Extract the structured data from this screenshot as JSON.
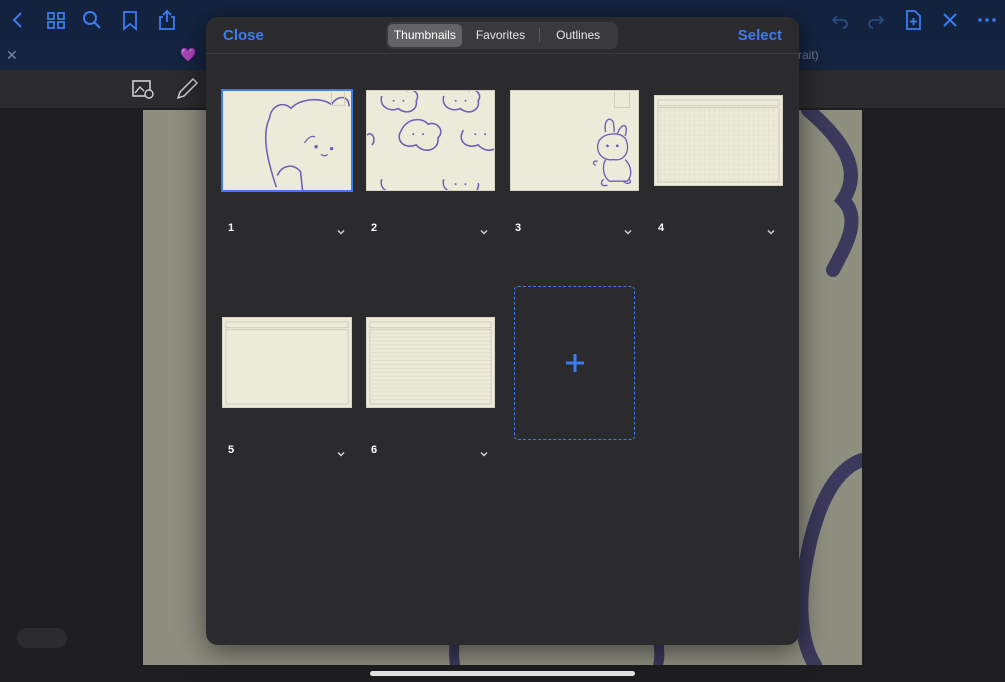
{
  "app": {
    "doc_title": "",
    "tab_title": "💜",
    "tab_right_text": "rait)"
  },
  "colors": {
    "accent": "#3d7bf0",
    "modal_bg": "#2b2b2e",
    "paper": "#ecebd9",
    "doodle": "#6e5fb8"
  },
  "topbar": {
    "icons": [
      "back-icon",
      "grid-icon",
      "search-icon",
      "bookmark-icon",
      "share-icon",
      "undo-icon",
      "redo-icon",
      "add-page-icon",
      "close-icon",
      "more-icon"
    ]
  },
  "modal": {
    "close_label": "Close",
    "select_label": "Select",
    "segments": [
      {
        "label": "Thumbnails",
        "active": true
      },
      {
        "label": "Favorites",
        "active": false
      },
      {
        "label": "Outlines",
        "active": false
      }
    ]
  },
  "thumbnails": [
    {
      "label": "1",
      "selected": true,
      "style": "bear"
    },
    {
      "label": "2",
      "selected": false,
      "style": "clouds"
    },
    {
      "label": "3",
      "selected": false,
      "style": "bunny"
    },
    {
      "label": "4",
      "selected": false,
      "style": "grid"
    },
    {
      "label": "5",
      "selected": false,
      "style": "blank"
    },
    {
      "label": "6",
      "selected": false,
      "style": "lined"
    }
  ]
}
